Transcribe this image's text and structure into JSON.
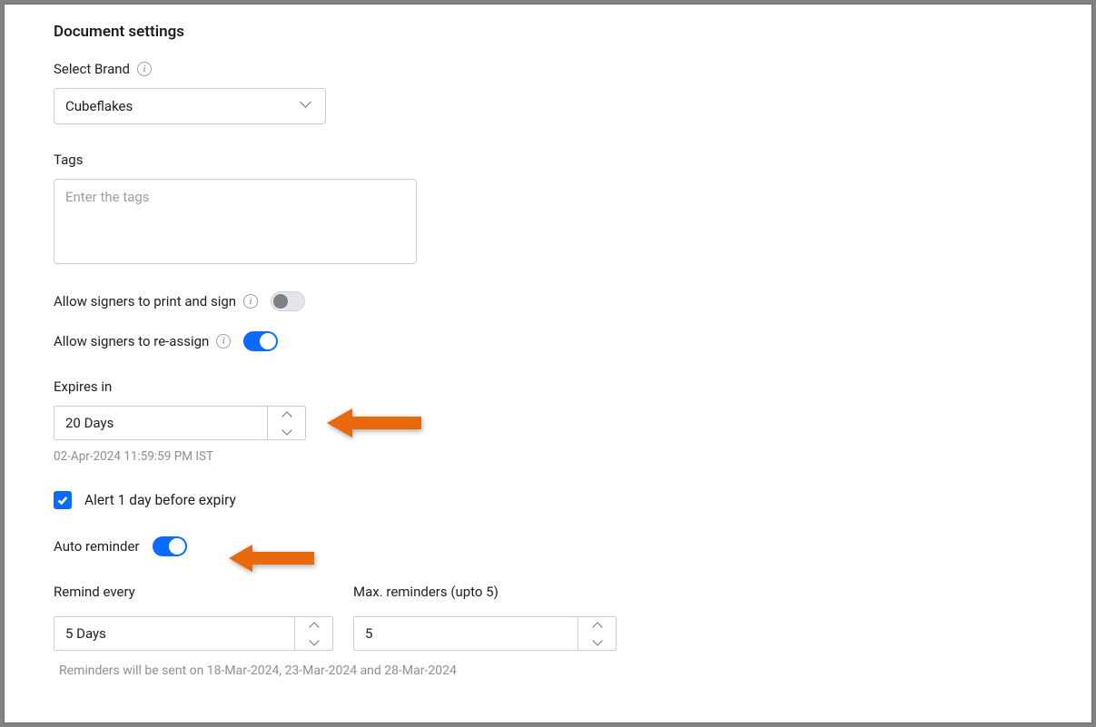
{
  "header": {
    "title": "Document settings"
  },
  "brand": {
    "label": "Select Brand",
    "value": "Cubeflakes"
  },
  "tags": {
    "label": "Tags",
    "placeholder": "Enter the tags"
  },
  "printAndSign": {
    "label": "Allow signers to print and sign",
    "enabled": false
  },
  "reassign": {
    "label": "Allow signers to re-assign",
    "enabled": true
  },
  "expires": {
    "label": "Expires in",
    "value": "20 Days",
    "hint": "02-Apr-2024 11:59:59 PM IST"
  },
  "alert": {
    "checked": true,
    "label": "Alert 1 day before expiry"
  },
  "autoReminder": {
    "label": "Auto reminder",
    "enabled": true
  },
  "remindEvery": {
    "label": "Remind every",
    "value": "5 Days"
  },
  "maxReminders": {
    "label": "Max. reminders (upto 5)",
    "value": "5"
  },
  "remindersHint": "Reminders will be sent on 18-Mar-2024, 23-Mar-2024 and 28-Mar-2024"
}
